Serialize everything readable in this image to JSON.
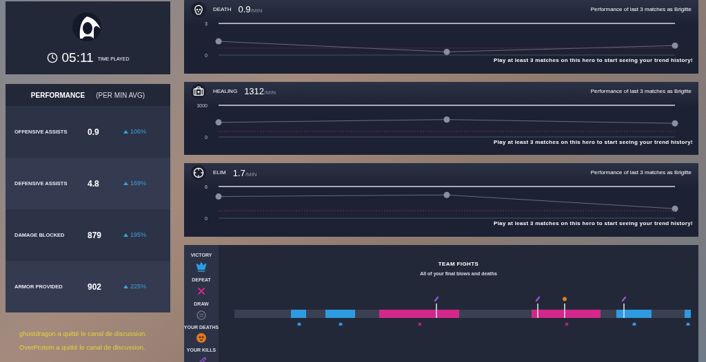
{
  "profile": {
    "time": "05:11",
    "time_label": "TIME PLAYED"
  },
  "performance": {
    "title": "PERFORMANCE",
    "subtitle": "(PER MIN AVG)",
    "rows": [
      {
        "label": "OFFENSIVE ASSISTS",
        "value": "0.9",
        "change": "106%"
      },
      {
        "label": "DEFENSIVE ASSISTS",
        "value": "4.8",
        "change": "169%"
      },
      {
        "label": "DAMAGE BLOCKED",
        "value": "879",
        "change": "195%"
      },
      {
        "label": "ARMOR PROVIDED",
        "value": "902",
        "change": "225%"
      }
    ]
  },
  "trend_cards": [
    {
      "kind": "death",
      "label": "DEATH",
      "value": "0.9",
      "unit": "/MIN",
      "caption": "Performance of last 3 matches as Brigitte",
      "notice": "Play at least 3 matches on this hero to start seeing your trend history!",
      "chart_data": {
        "type": "line",
        "ylim": [
          0,
          3
        ],
        "yticks": [
          0,
          3
        ],
        "series": [
          {
            "color": "#8a8f9c",
            "marker": "o",
            "values": [
              1.3,
              0.3,
              0.9
            ]
          },
          {
            "color": "#8c1f5e",
            "line_style": "dashed",
            "values": [
              0.66,
              0.66,
              0.66
            ]
          }
        ]
      }
    },
    {
      "kind": "healing",
      "label": "HEALING",
      "value": "1312",
      "unit": "/MIN",
      "caption": "Performance of last 3 matches as Brigitte",
      "notice": "Play at least 3 matches on this hero to start seeing your trend history!",
      "chart_data": {
        "type": "line",
        "ylim": [
          0,
          3000
        ],
        "yticks": [
          0,
          3000
        ],
        "series": [
          {
            "color": "#8a8f9c",
            "marker": "o",
            "values": [
              1380,
              1650,
              1290
            ]
          },
          {
            "color": "#8c1f5e",
            "line_style": "dashed",
            "values": [
              530,
              530,
              530
            ]
          }
        ]
      }
    },
    {
      "kind": "elim",
      "label": "ELIM",
      "value": "1.7",
      "unit": "/MIN",
      "caption": "Performance of last 3 matches as Brigitte",
      "notice": "Play at least 3 matches on this hero to start seeing your trend history!",
      "chart_data": {
        "type": "line",
        "ylim": [
          0,
          6
        ],
        "yticks": [
          0,
          6
        ],
        "series": [
          {
            "color": "#8a8f9c",
            "marker": "o",
            "values": [
              4.1,
              4.4,
              1.8
            ]
          },
          {
            "color": "#8c1f5e",
            "line_style": "dashed",
            "values": [
              1.4,
              1.4,
              1.4
            ]
          }
        ]
      }
    }
  ],
  "team_fights": {
    "title": "TEAM FIGHTS",
    "subtitle": "All of your final blows and deaths",
    "legend": [
      {
        "kind": "victory",
        "label": "VICTORY"
      },
      {
        "kind": "defeat",
        "label": "DEFEAT"
      },
      {
        "kind": "draw",
        "label": "DRAW"
      },
      {
        "kind": "deaths",
        "label": "YOUR DEATHS"
      },
      {
        "kind": "kills",
        "label": "YOUR KILLS"
      }
    ]
  },
  "chat": [
    {
      "text": "ghostdragon a quitté le canal de discussion."
    },
    {
      "text": "OverProtein a quitté le canal de discussion."
    }
  ]
}
